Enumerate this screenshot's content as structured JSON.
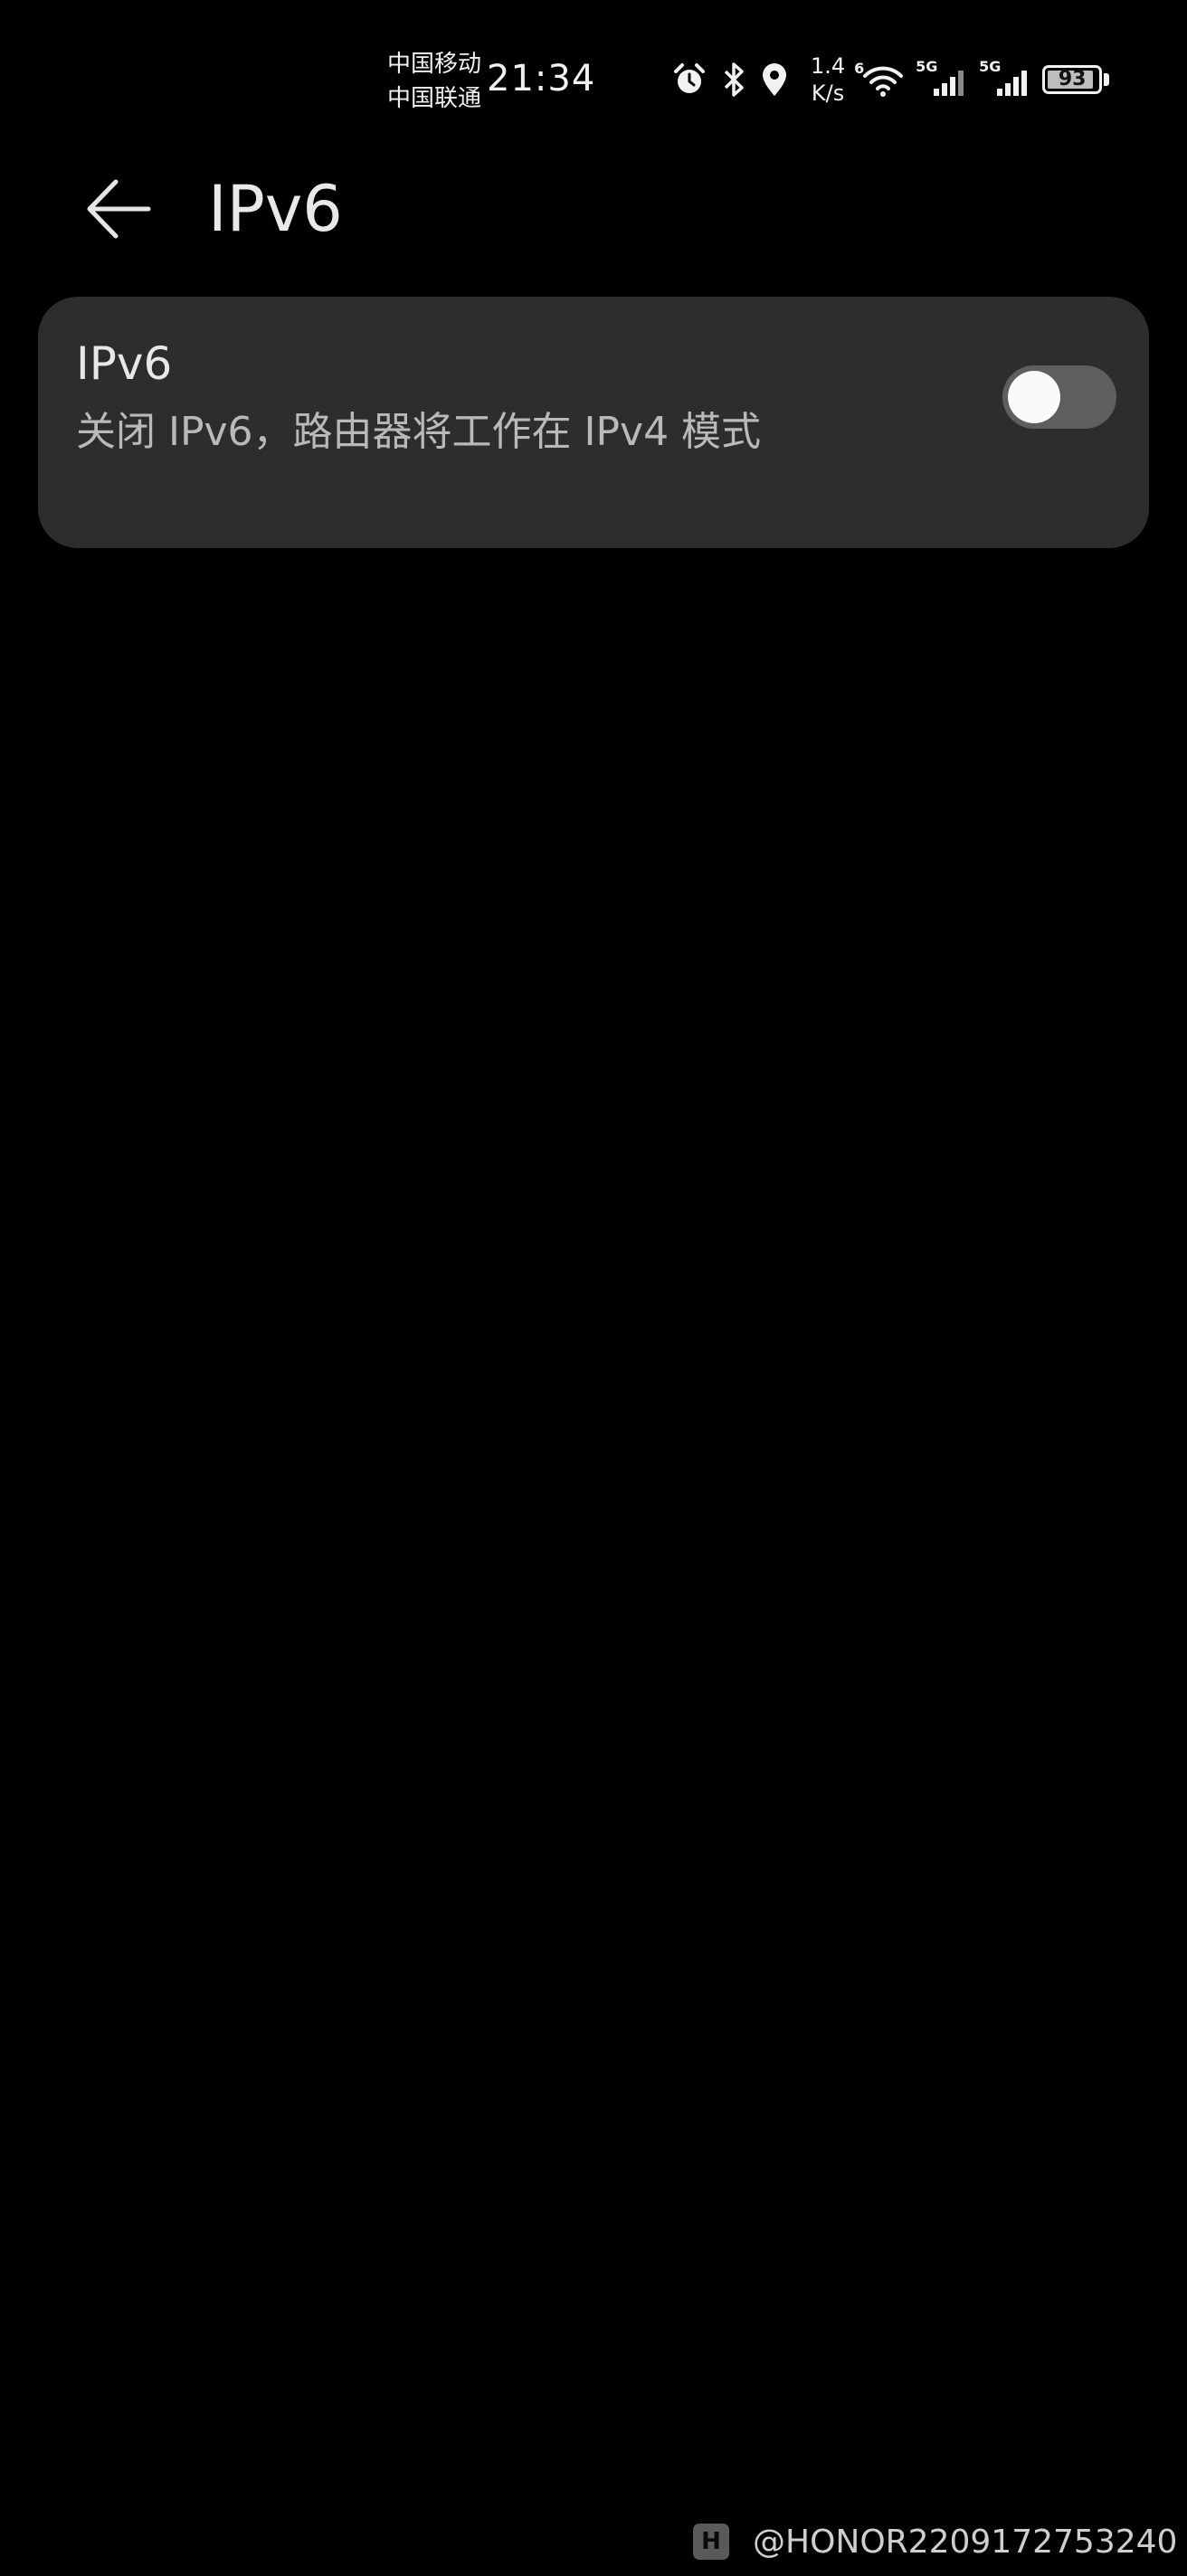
{
  "status_bar": {
    "carrier_1": "中国移动",
    "carrier_2": "中国联通",
    "time": "21:34",
    "net_speed_value": "1.4",
    "net_speed_unit": "K/s",
    "wifi_badge": "6",
    "signal_1_label": "5G",
    "signal_2_label": "5G",
    "battery_percent": "93",
    "battery_level": 0.93,
    "icons": [
      "alarm-icon",
      "bluetooth-icon",
      "location-icon",
      "wifi-icon",
      "signal-icon",
      "signal-icon",
      "battery-icon"
    ]
  },
  "header": {
    "title": "IPv6",
    "back_icon": "arrow-left-icon"
  },
  "setting": {
    "title": "IPv6",
    "description": "关闭 IPv6，路由器将工作在 IPv4 模式",
    "enabled": false
  },
  "watermark": {
    "logo_letter": "H",
    "text": "@HONOR2209172753240"
  }
}
